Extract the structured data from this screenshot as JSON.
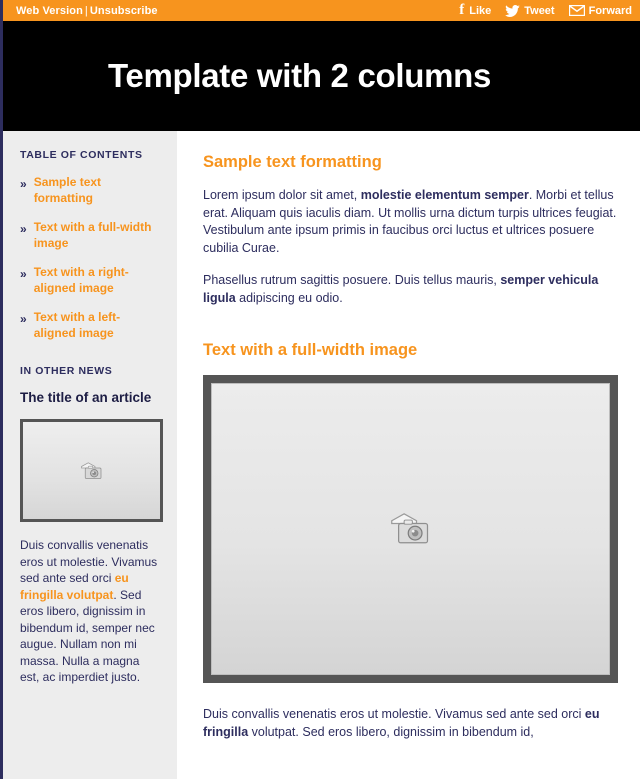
{
  "topbar": {
    "web_version_label": "Web Version",
    "separator": "|",
    "unsubscribe_label": "Unsubscribe",
    "social": [
      {
        "icon": "facebook-icon",
        "label": "Like"
      },
      {
        "icon": "twitter-icon",
        "label": "Tweet"
      },
      {
        "icon": "envelope-icon",
        "label": "Forward"
      }
    ],
    "background_color": "#f7941e",
    "text_color": "#ffffff"
  },
  "banner": {
    "title": "Template with 2 columns",
    "background_color": "#000000",
    "text_color": "#ffffff"
  },
  "sidebar": {
    "toc_heading": "TABLE OF CONTENTS",
    "toc_bullet": "»",
    "toc_items": [
      {
        "label": "Sample text formatting"
      },
      {
        "label": "Text with a full-width image"
      },
      {
        "label": "Text with a right-aligned image"
      },
      {
        "label": "Text with a left-aligned image"
      }
    ],
    "other_news_heading": "IN OTHER NEWS",
    "article_title": "The title of an article",
    "article_image_alt": "image-placeholder",
    "article_text_part1": "Duis convallis venenatis eros ut molestie. Vivamus sed ante sed orci ",
    "article_link": "eu fringilla volutpat",
    "article_text_part2": ". Sed eros libero, dignissim in bibendum id, semper nec augue. Nullam non mi massa. Nulla a magna est, ac imperdiet justo.",
    "background_color": "#ededed",
    "link_color": "#f7941e",
    "text_color": "#2d2d5e"
  },
  "main": {
    "section1_title": "Sample text formatting",
    "section1_p1_a": "Lorem ipsum dolor sit amet, ",
    "section1_p1_bold": "molestie elementum semper",
    "section1_p1_b": ". Morbi et tellus erat. Aliquam quis iaculis diam. Ut mollis urna dictum turpis ultrices feugiat. Vestibulum ante ipsum primis in faucibus orci luctus et ultrices posuere cubilia Curae.",
    "section1_p2_a": "Phasellus rutrum sagittis posuere. Duis tellus mauris, ",
    "section1_p2_bold": "semper vehicula ligula",
    "section1_p2_b": " adipiscing eu odio.",
    "section2_title": "Text with a full-width image",
    "section2_image_alt": "image-placeholder",
    "section2_p_a": "Duis convallis venenatis eros ut molestie. Vivamus sed ante sed orci ",
    "section2_p_bold": "eu fringilla",
    "section2_p_b": " volutpat. Sed eros libero, dignissim in bibendum id,",
    "heading_color": "#f7941e",
    "text_color": "#2d2d5e"
  }
}
